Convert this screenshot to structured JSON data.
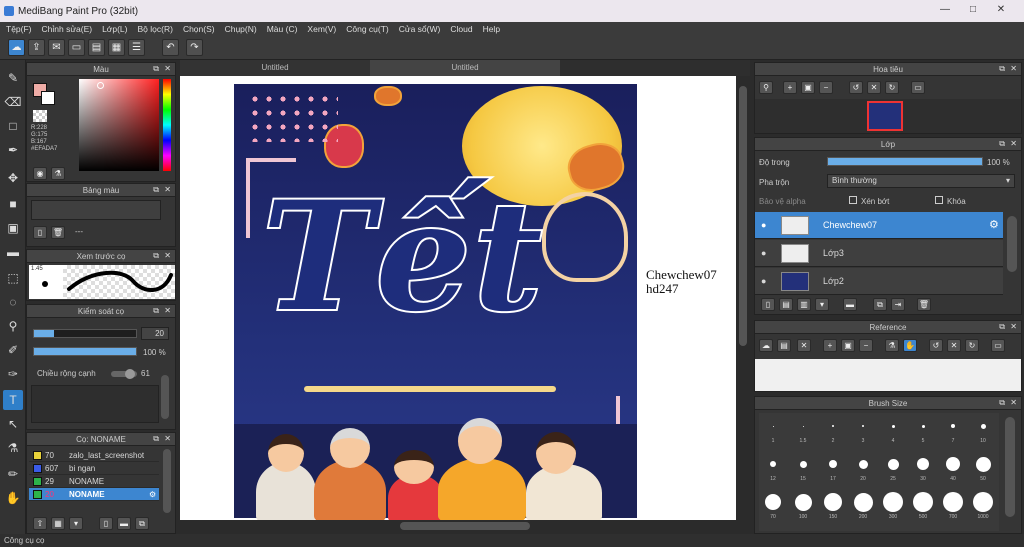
{
  "window": {
    "title": "MediBang Paint Pro (32bit)",
    "min": "—",
    "max": "□",
    "close": "✕"
  },
  "menu": [
    "Tệp(F)",
    "Chỉnh sửa(E)",
    "Lớp(L)",
    "Bộ lọc(R)",
    "Chọn(S)",
    "Chụp(N)",
    "Màu (C)",
    "Xem(V)",
    "Công cụ(T)",
    "Cửa sổ(W)",
    "Cloud",
    "Help"
  ],
  "color_panel": {
    "title": "Màu",
    "values": [
      "R:228",
      "G:175",
      "B:167",
      "#EFADA7"
    ]
  },
  "brush_colors_panel": {
    "title": "Bảng màu",
    "dash": "---"
  },
  "preview_panel": {
    "title": "Xem trước cọ",
    "size": "1.45"
  },
  "brush_control": {
    "title": "Kiểm soát cọ",
    "size": "20",
    "opacity": "100 %",
    "edge_label": "Chiều rộng cạnh",
    "edge": "61",
    "opacity_fraction": 1.0,
    "size_fraction": 0.2
  },
  "brush_list": {
    "title": "Cọ: NONAME",
    "items": [
      {
        "color": "#e8d23a",
        "size": "70",
        "name": "zalo_last_screenshot"
      },
      {
        "color": "#3a5be8",
        "size": "607",
        "name": "bi ngan"
      },
      {
        "color": "#2db34a",
        "size": "29",
        "name": "NONAME"
      },
      {
        "color": "#2db34a",
        "size": "20",
        "name": "NONAME"
      }
    ]
  },
  "tabs": [
    "Untitled",
    "Untitled"
  ],
  "artwork": {
    "text": "Tết"
  },
  "watermark": {
    "line1": "Chewchew07",
    "line2": "hd247"
  },
  "navigator": {
    "title": "Hoa tiêu"
  },
  "layer_panel": {
    "title": "Lớp",
    "opacity_label": "Độ trong",
    "opacity": "100 %",
    "opacity_fraction": 1.0,
    "blend_label": "Pha trộn",
    "blend": "Bình thường",
    "protect_alpha": "Bảo vệ alpha",
    "clip": "Xén bớt",
    "lock": "Khóa",
    "layers": [
      {
        "name": "Chewchew07",
        "selected": true
      },
      {
        "name": "Lớp3",
        "selected": false
      },
      {
        "name": "Lớp2",
        "selected": false
      }
    ]
  },
  "reference_panel": {
    "title": "Reference"
  },
  "brush_size_panel": {
    "title": "Brush Size",
    "row1": [
      "1",
      "1.5",
      "2",
      "3",
      "4",
      "5",
      "7",
      "10"
    ],
    "row2": [
      "12",
      "15",
      "17",
      "20",
      "25",
      "30",
      "40",
      "50"
    ],
    "row3": [
      "70",
      "100",
      "150",
      "200",
      "300",
      "500",
      "700",
      "1000"
    ]
  },
  "status": {
    "text": "Công cụ cọ"
  },
  "colors": {
    "accent": "#3d86d0",
    "primary": "#EFADA7"
  }
}
